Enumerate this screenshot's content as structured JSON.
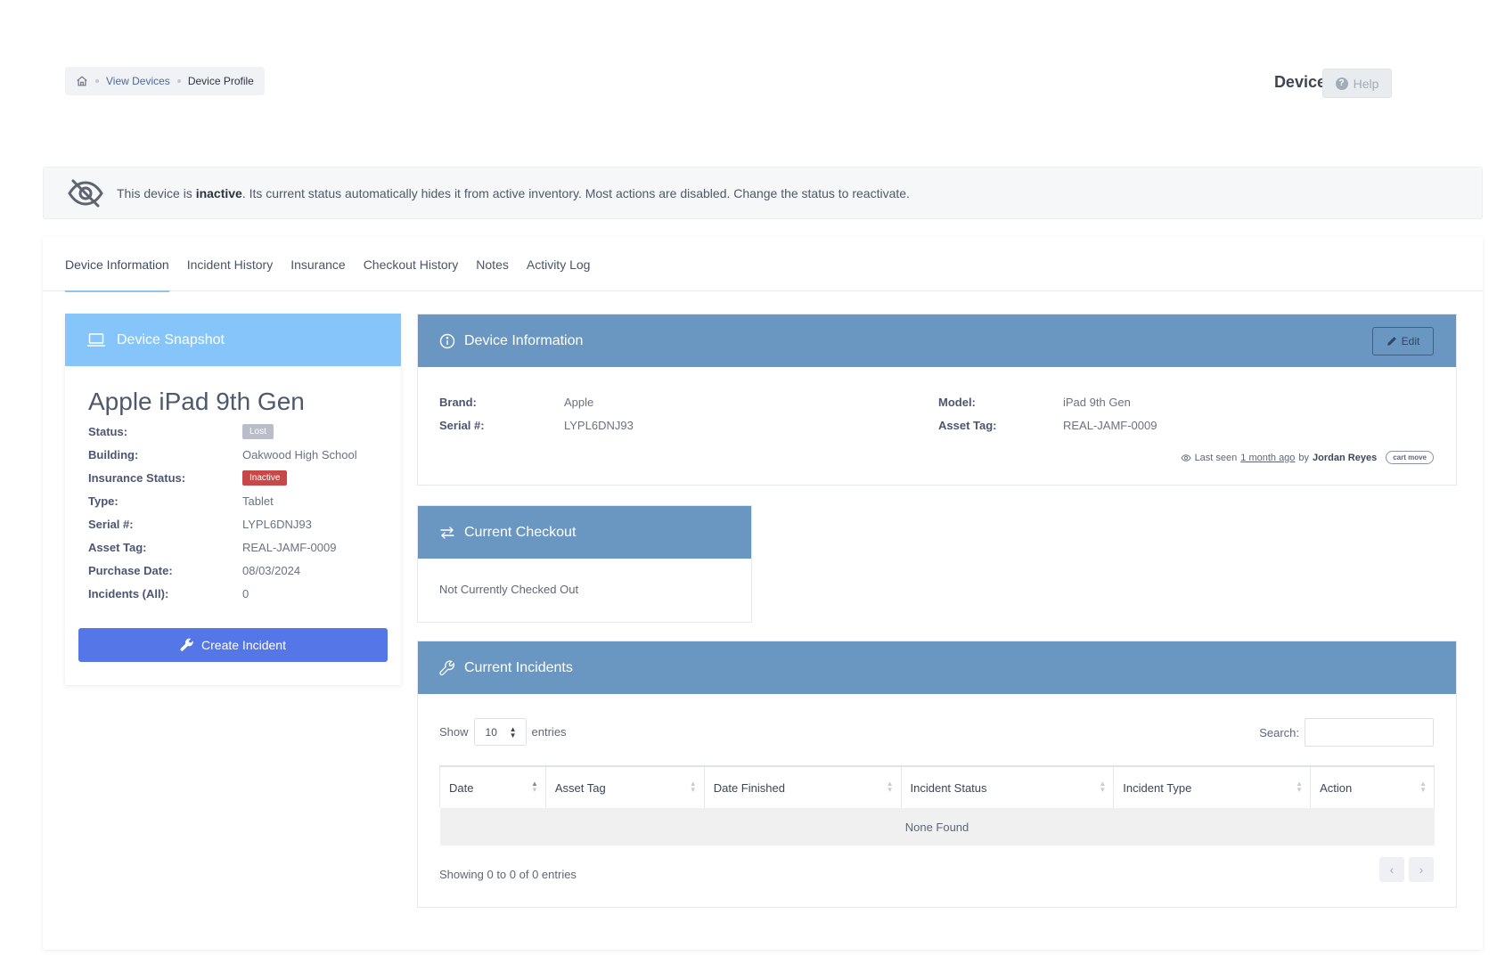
{
  "breadcrumb": {
    "home": "home-icon",
    "link": "View Devices",
    "current": "Device Profile"
  },
  "header": {
    "title": "Device Profile",
    "help_label": "Help"
  },
  "banner": {
    "prefix": "This device is ",
    "emphasis": "inactive",
    "suffix": ". Its current status automatically hides it from active inventory. Most actions are disabled. Change the status to reactivate."
  },
  "tabs": [
    {
      "label": "Device Information"
    },
    {
      "label": "Incident History"
    },
    {
      "label": "Insurance"
    },
    {
      "label": "Checkout History"
    },
    {
      "label": "Notes"
    },
    {
      "label": "Activity Log"
    }
  ],
  "snapshot": {
    "title": "Device Snapshot",
    "device_name": "Apple iPad 9th Gen",
    "rows": [
      {
        "key": "Status:",
        "value": "Lost"
      },
      {
        "key": "Building:",
        "value": "Oakwood High School"
      },
      {
        "key": "Insurance Status:",
        "value": "Inactive"
      },
      {
        "key": "Type:",
        "value": "Tablet"
      },
      {
        "key": "Serial #:",
        "value": "LYPL6DNJ93"
      },
      {
        "key": "Asset Tag:",
        "value": "REAL-JAMF-0009"
      },
      {
        "key": "Purchase Date:",
        "value": "08/03/2024"
      },
      {
        "key": "Incidents (All):",
        "value": "0"
      }
    ],
    "create_label": "Create Incident"
  },
  "device_info": {
    "title": "Device Information",
    "edit_label": "Edit",
    "brand_key": "Brand:",
    "brand": "Apple",
    "model_key": "Model:",
    "model": "iPad 9th Gen",
    "serial_key": "Serial #:",
    "serial": "LYPL6DNJ93",
    "asset_key": "Asset Tag:",
    "asset": "REAL-JAMF-0009",
    "last_seen_prefix": "Last seen",
    "last_seen_time": "1 month ago",
    "last_seen_by": "by",
    "last_seen_user": "Jordan Reyes",
    "last_seen_badge": "cart move"
  },
  "checkout": {
    "title": "Current Checkout",
    "text": "Not Currently Checked Out"
  },
  "incidents": {
    "title": "Current Incidents",
    "show_label": "Show",
    "entries_value": "10",
    "entries_label": "entries",
    "search_label": "Search:",
    "columns": [
      "Date",
      "Asset Tag",
      "Date Finished",
      "Incident Status",
      "Incident Type",
      "Action"
    ],
    "empty_text": "None Found",
    "info": "Showing 0 to 0 of 0 entries",
    "prev": "‹",
    "next": "›"
  },
  "colors": {
    "accent": "#5476e6",
    "panel_header": "#6a97c2",
    "snapshot_header": "#86c5f9",
    "inactive": "#c74848"
  }
}
